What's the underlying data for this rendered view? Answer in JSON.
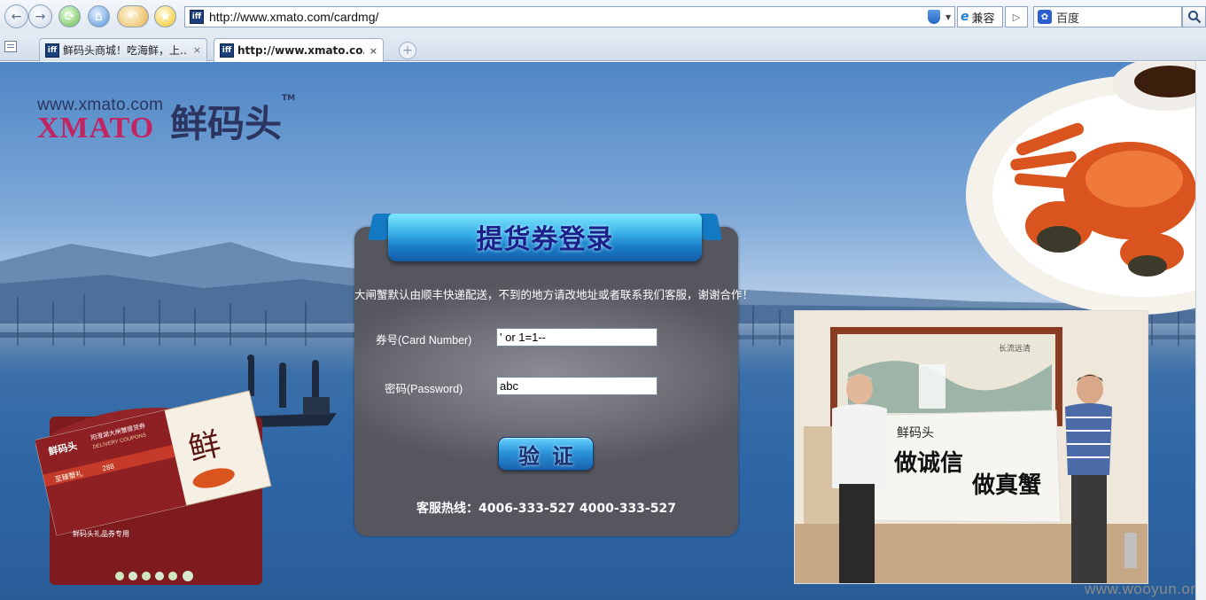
{
  "browser": {
    "url": "http://www.xmato.com/cardmg/",
    "compat_label": "兼容",
    "search_placeholder": "百度",
    "favicon_text": "iff",
    "tabs": [
      {
        "label": "鲜码头商城！吃海鲜，上…",
        "active": false
      },
      {
        "label": "http://www.xmato.co…",
        "active": true
      }
    ],
    "tab_close": "×",
    "new_tab": "+"
  },
  "logo": {
    "url_text": "www.xmato.com",
    "brand_text": "XMATO",
    "cn_text": "鲜码头",
    "tm": "TM"
  },
  "login": {
    "title": "提货券登录",
    "notice": "大闸蟹默认由顺丰快递配送，不到的地方请改地址或者联系我们客服，谢谢合作！",
    "card_label": "券号(Card Number)",
    "card_value": "' or 1=1--",
    "password_label": "密码(Password)",
    "password_value": "abc",
    "submit_label": "验证",
    "hotline": "客服热线：4006-333-527 4000-333-527"
  },
  "coupon": {
    "brand": "鲜码头",
    "title": "阳澄湖大闸蟹提货券",
    "subtitle": "DELIVERY COUPONS",
    "price_label": "至臻蟹礼",
    "price": "288",
    "envelope_text": "鲜码头礼品券专用",
    "card_char": "鲜"
  },
  "photo": {
    "calligraphy_top": "鲜码头",
    "calligraphy_main_1": "做诚信",
    "calligraphy_main_2": "做真蟹",
    "painting_title": "长流远清"
  },
  "watermark": "www.wooyun.org",
  "colors": {
    "brand_pink": "#c22462",
    "brand_navy": "#2b3560",
    "ribbon_blue": "#1a7cc8"
  }
}
